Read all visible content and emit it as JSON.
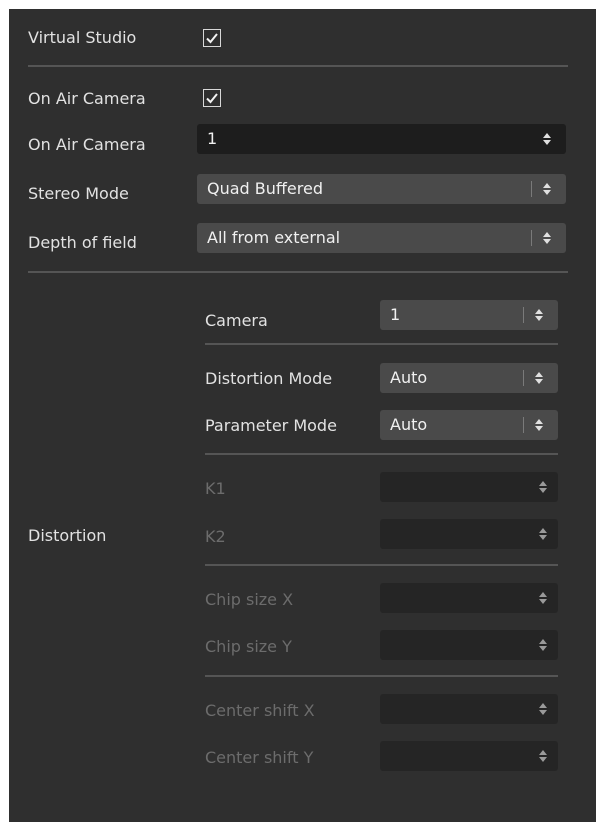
{
  "virtual_studio": {
    "label": "Virtual Studio",
    "checked": true
  },
  "on_air_camera_toggle": {
    "label": "On Air Camera",
    "checked": true
  },
  "on_air_camera_value": {
    "label": "On Air Camera",
    "value": "1"
  },
  "stereo_mode": {
    "label": "Stereo Mode",
    "value": "Quad Buffered"
  },
  "depth_of_field": {
    "label": "Depth of field",
    "value": "All from external"
  },
  "distortion": {
    "label": "Distortion",
    "camera": {
      "label": "Camera",
      "value": "1"
    },
    "distortion_mode": {
      "label": "Distortion Mode",
      "value": "Auto"
    },
    "parameter_mode": {
      "label": "Parameter Mode",
      "value": "Auto"
    },
    "k1": {
      "label": "K1",
      "value": ""
    },
    "k2": {
      "label": "K2",
      "value": ""
    },
    "chip_size_x": {
      "label": "Chip size X",
      "value": ""
    },
    "chip_size_y": {
      "label": "Chip size Y",
      "value": ""
    },
    "center_shift_x": {
      "label": "Center shift X",
      "value": ""
    },
    "center_shift_y": {
      "label": "Center shift Y",
      "value": ""
    }
  },
  "colors": {
    "panel_bg": "#2f2f2f",
    "label_text": "#e2e2e2",
    "disabled_text": "#6c6c6c",
    "select_bg": "#4a4a4a",
    "spinbox_bg": "#1d1d1d",
    "divider": "#555555"
  },
  "icons": {
    "check": "check-icon",
    "stepper": "up-down-arrows-icon"
  }
}
